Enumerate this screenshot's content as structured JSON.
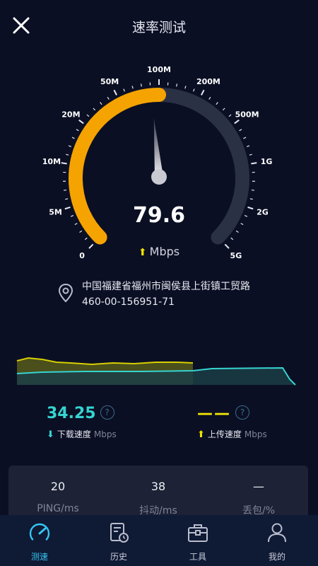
{
  "header": {
    "title": "速率测试"
  },
  "gauge": {
    "value": "79.6",
    "unit": "Mbps",
    "fill_fraction": 0.5,
    "tick_labels": [
      "0",
      "5M",
      "10M",
      "20M",
      "50M",
      "100M",
      "200M",
      "500M",
      "1G",
      "2G",
      "5G"
    ],
    "colors": {
      "active": "#f5a300",
      "track": "#2b3145",
      "needle": "#ffffff"
    }
  },
  "location": {
    "address": "中国福建省福州市闽侯县上街镇工贸路",
    "code": "460-00-156951-71"
  },
  "download": {
    "value": "34.25",
    "label": "下载速度",
    "unit": "Mbps",
    "color": "#35d4d0"
  },
  "upload": {
    "value": "——",
    "label": "上传速度",
    "unit": "Mbps",
    "color": "#f2e600"
  },
  "metrics": [
    {
      "value": "20",
      "label": "PING/ms"
    },
    {
      "value": "38",
      "label": "抖动/ms"
    },
    {
      "value": "—",
      "label": "丢包/%"
    }
  ],
  "nav": [
    {
      "label": "测速",
      "icon": "speedometer-icon"
    },
    {
      "label": "历史",
      "icon": "history-icon"
    },
    {
      "label": "工具",
      "icon": "toolbox-icon"
    },
    {
      "label": "我的",
      "icon": "user-icon"
    }
  ]
}
